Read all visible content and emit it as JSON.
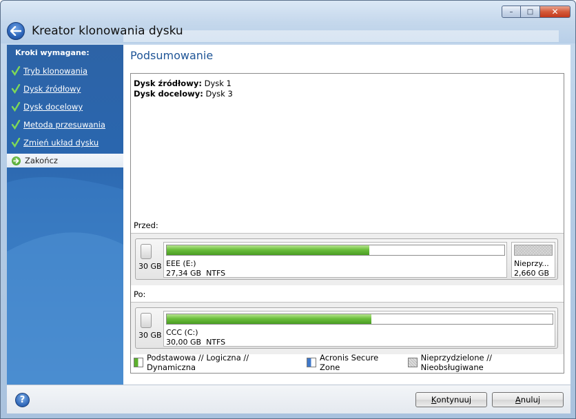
{
  "window": {
    "title": "Kreator klonowania dysku",
    "caption_minimize": "–",
    "caption_maximize": "□",
    "caption_close": "✕"
  },
  "sidebar": {
    "heading": "Kroki wymagane:",
    "steps": [
      {
        "label": "Tryb klonowania",
        "state": "done"
      },
      {
        "label": "Dysk źródłowy",
        "state": "done"
      },
      {
        "label": "Dysk docelowy",
        "state": "done"
      },
      {
        "label": "Metoda przesuwania",
        "state": "done"
      },
      {
        "label": "Zmień układ dysku",
        "state": "done"
      },
      {
        "label": "Zakończ",
        "state": "current"
      }
    ]
  },
  "main": {
    "page_title": "Podsumowanie",
    "source_label": "Dysk źródłowy:",
    "source_value": " Dysk 1",
    "target_label": "Dysk docelowy:",
    "target_value": " Dysk 3",
    "before_label": "Przed:",
    "after_label": "Po:",
    "before_disk": {
      "size": "30 GB",
      "partition": {
        "name": "EEE (E:)",
        "size": "27,34 GB",
        "fs": "NTFS",
        "used_fraction": 0.6
      },
      "unallocated": {
        "name": "Nieprzy...",
        "size": "2,660 GB"
      }
    },
    "after_disk": {
      "size": "30 GB",
      "partition": {
        "name": "CCC (C:)",
        "size": "30,00 GB",
        "fs": "NTFS",
        "used_fraction": 0.53
      }
    },
    "legend": [
      {
        "label": "Podstawowa // Logiczna // Dynamiczna",
        "swatch": "green"
      },
      {
        "label": "Acronis Secure Zone",
        "swatch": "blue"
      },
      {
        "label": "Nieprzydzielone // Nieobsługiwane",
        "swatch": "gray"
      }
    ]
  },
  "footer": {
    "help": "?",
    "continue_mnemonic": "K",
    "continue_rest": "ontynuuj",
    "cancel_mnemonic": "A",
    "cancel_rest": "nuluj"
  },
  "colors": {
    "accent": "#1f5597",
    "sidebar": "#2a66ae",
    "bar_green": "#6cbf3d"
  }
}
